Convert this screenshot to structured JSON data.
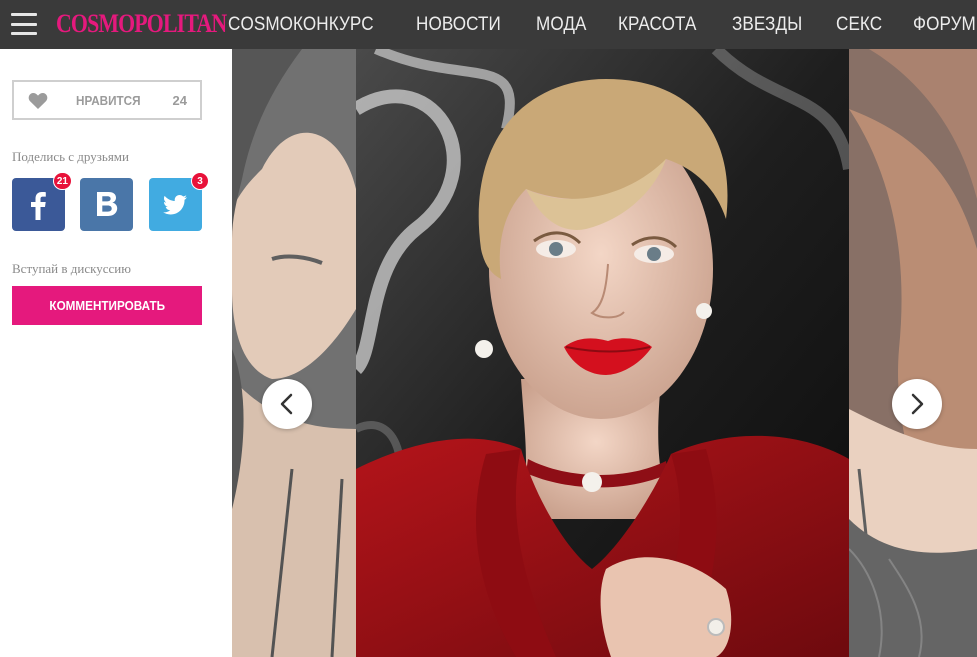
{
  "header": {
    "logo_text": "COSMOPOLITAN",
    "nav_items": [
      {
        "label": "COSMOКОНКУРС"
      },
      {
        "label": "НОВОСТИ"
      },
      {
        "label": "МОДА"
      },
      {
        "label": "КРАСОТА"
      },
      {
        "label": "ЗВЕЗДЫ"
      },
      {
        "label": "СЕКС"
      },
      {
        "label": "ФОРУМ"
      }
    ],
    "menu_icon": "hamburger-icon"
  },
  "sidebar": {
    "like": {
      "label": "НРАВИТСЯ",
      "count": "24",
      "icon": "heart-icon"
    },
    "share_caption": "Поделись с друзьями",
    "share": [
      {
        "network": "facebook",
        "icon": "facebook-icon",
        "count": "21"
      },
      {
        "network": "vkontakte",
        "icon": "vk-icon",
        "count": ""
      },
      {
        "network": "twitter",
        "icon": "twitter-icon",
        "count": "3"
      }
    ],
    "discussion_caption": "Вступай в дискуссию",
    "comment_button": "КОММЕНТИРОВАТЬ"
  },
  "gallery": {
    "prev_icon": "chevron-left-icon",
    "next_icon": "chevron-right-icon"
  },
  "colors": {
    "brand_pink": "#e5197d",
    "topbar": "#3a3a3a",
    "facebook": "#3b5998",
    "vk": "#4a76a8",
    "twitter": "#41abe1",
    "badge": "#e8123a"
  }
}
